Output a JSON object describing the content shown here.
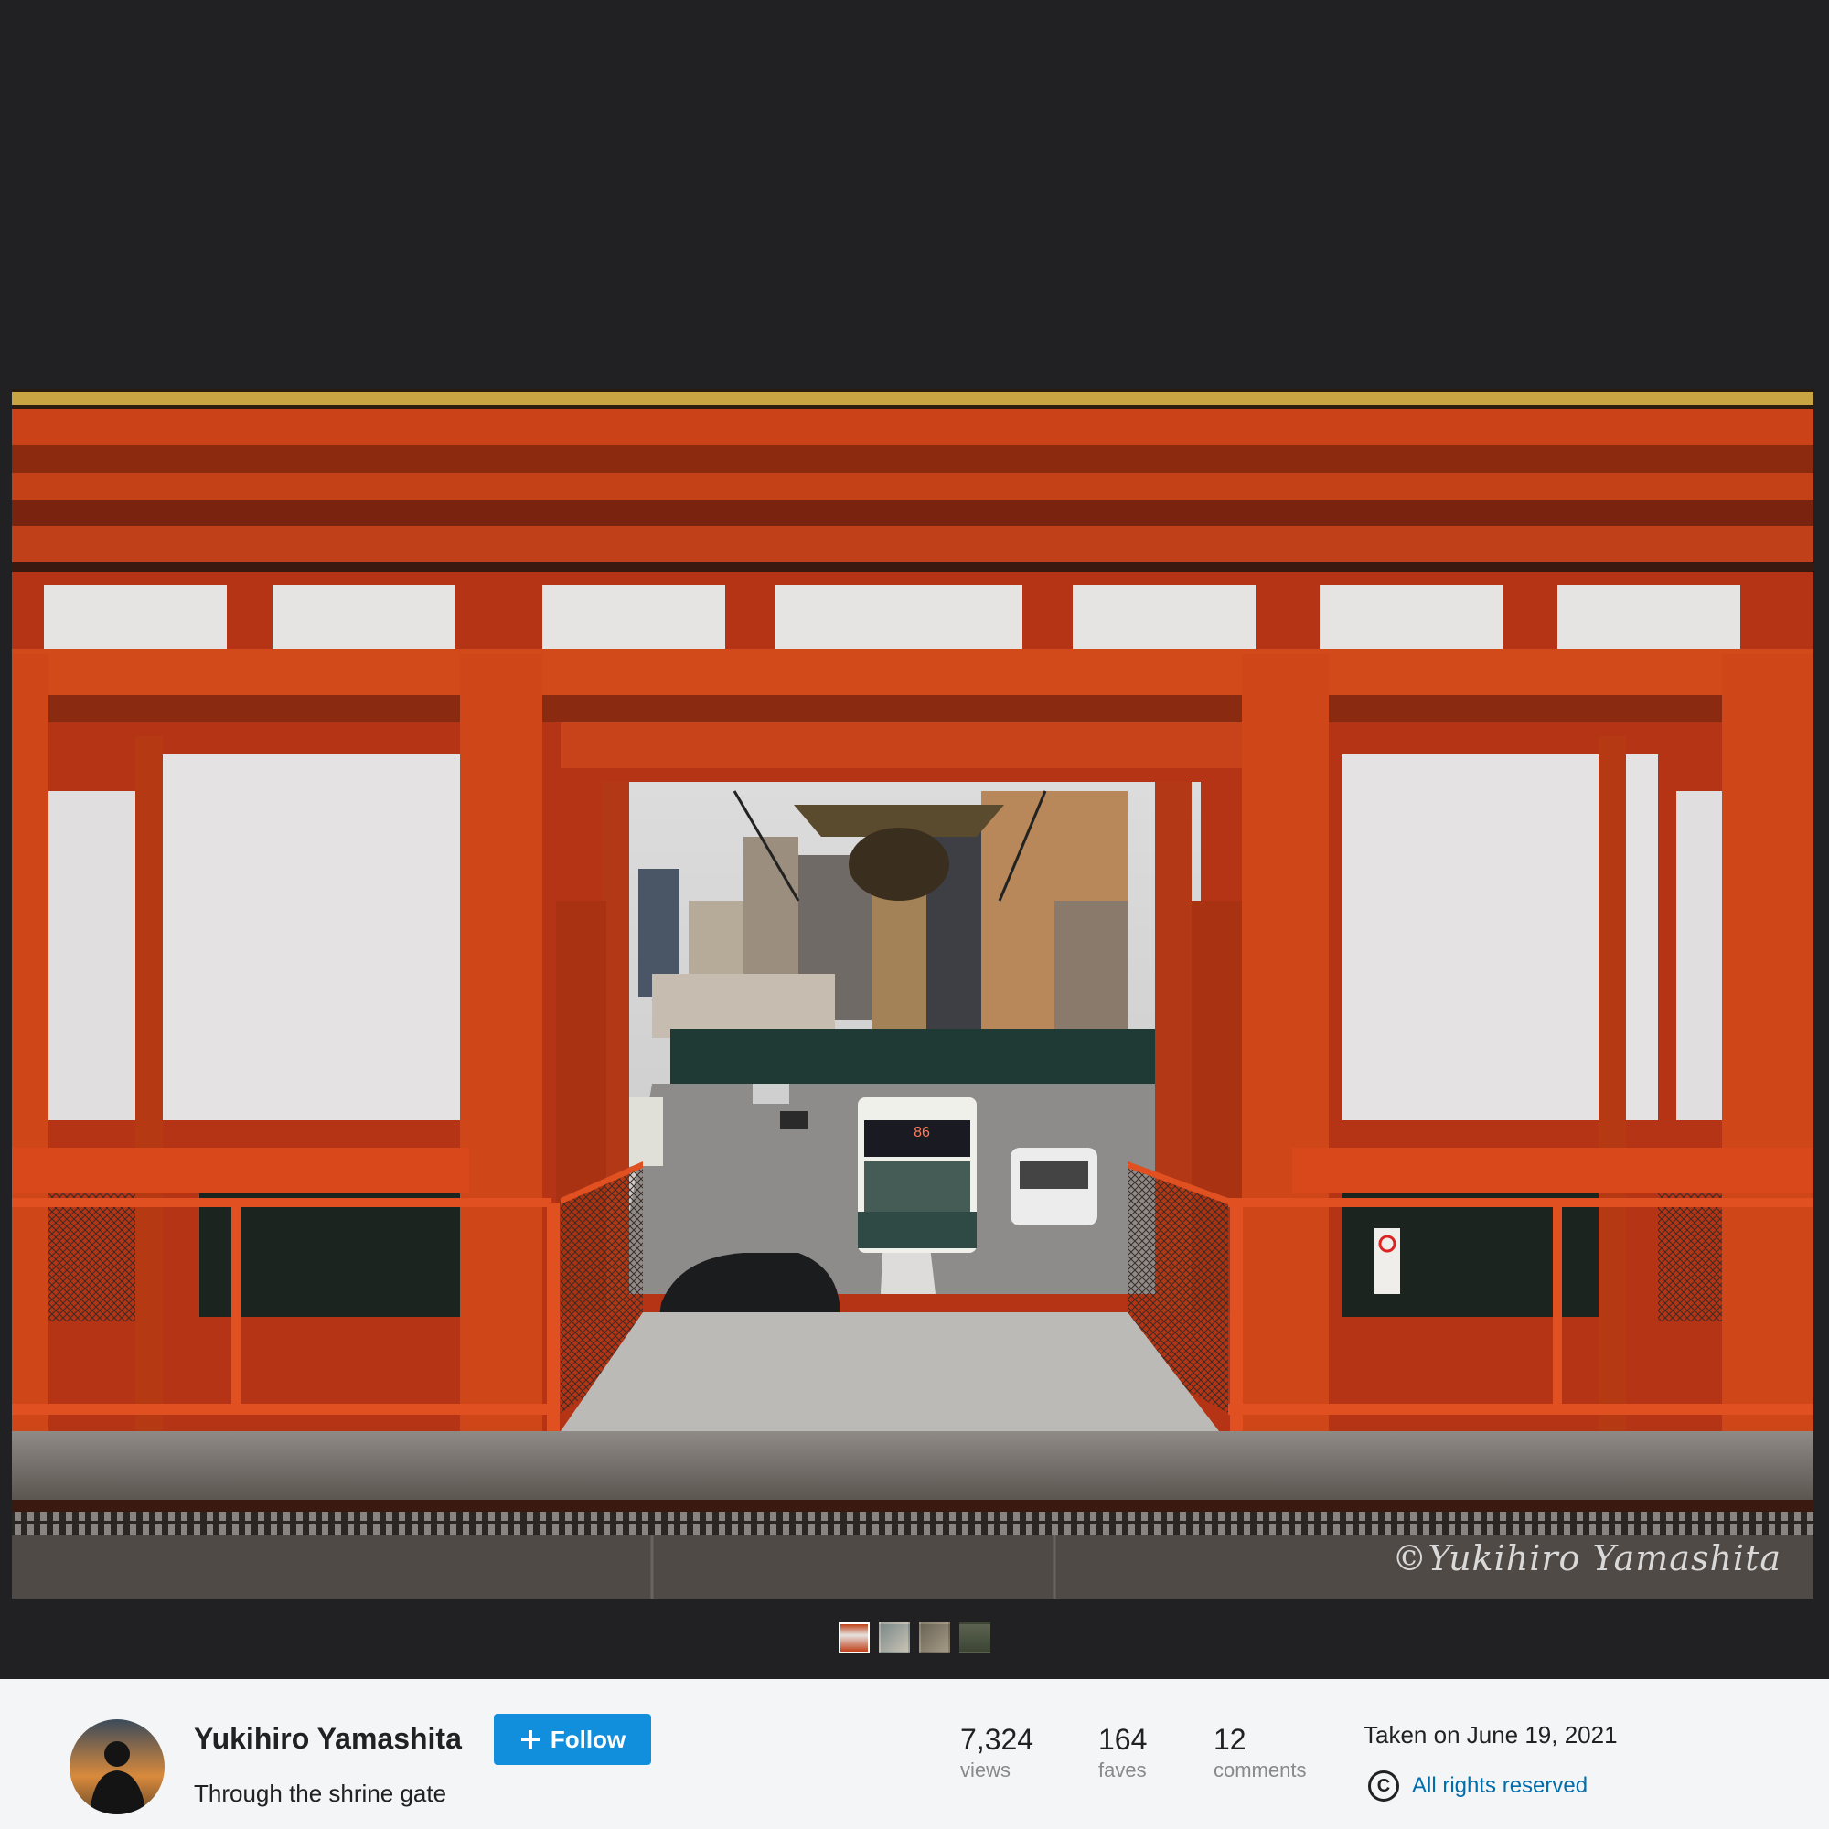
{
  "photo": {
    "watermark": "©Yukihiro Yamashita",
    "bus_number": "86"
  },
  "thumbnails": [
    {
      "name": "thumb-1",
      "active": true
    },
    {
      "name": "thumb-2",
      "active": false
    },
    {
      "name": "thumb-3",
      "active": false
    },
    {
      "name": "thumb-4",
      "active": false
    }
  ],
  "owner": {
    "name": "Yukihiro Yamashita",
    "follow_label": "Follow"
  },
  "photo_info": {
    "title": "Through the shrine gate",
    "views": "7,324",
    "views_label": "views",
    "faves": "164",
    "faves_label": "faves",
    "comments": "12",
    "comments_label": "comments",
    "taken": "Taken on June 19, 2021",
    "license": "All rights reserved",
    "license_icon": "copyright-icon"
  },
  "colors": {
    "accent": "#128fdc",
    "link": "#006dac",
    "viewer_bg": "#212124",
    "gate_red": "#c8401a"
  }
}
